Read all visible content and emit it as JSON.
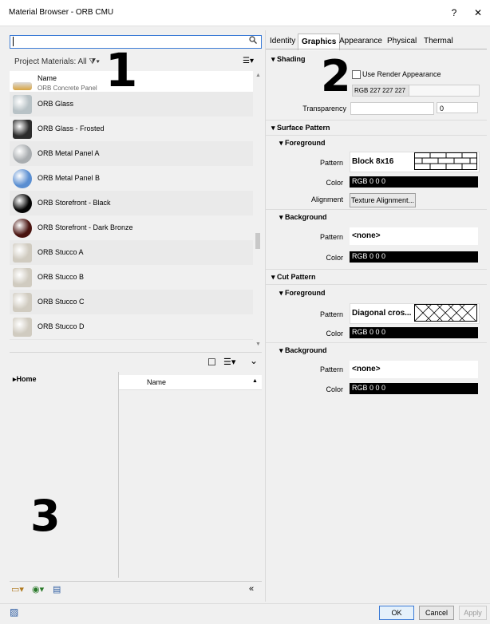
{
  "window": {
    "title": "Material Browser - ORB CMU",
    "help_label": "?",
    "close_label": "✕"
  },
  "search": {
    "value": "",
    "icon": "search-icon"
  },
  "project_materials": {
    "label": "Project Materials: All"
  },
  "list": {
    "column_header": "Name",
    "partial_item": "ORB Concrete Panel",
    "items": [
      {
        "label": "ORB Glass",
        "swatch": "#b8c2c6"
      },
      {
        "label": "ORB Glass - Frosted",
        "swatch": "#2c2c2c"
      },
      {
        "label": "ORB Metal Panel A",
        "swatch": "#a9adb0"
      },
      {
        "label": "ORB Metal Panel B",
        "swatch": "#5a8ed1"
      },
      {
        "label": "ORB Storefront - Black",
        "swatch": "#050505"
      },
      {
        "label": "ORB Storefront - Dark Bronze",
        "swatch": "#4a1410"
      },
      {
        "label": "ORB Stucco A",
        "swatch": "#d0cbc0"
      },
      {
        "label": "ORB Stucco B",
        "swatch": "#d0cbc0"
      },
      {
        "label": "ORB Stucco C",
        "swatch": "#d0cbc0"
      },
      {
        "label": "ORB Stucco D",
        "swatch": "#d0cbc0"
      }
    ]
  },
  "library": {
    "home_label": "Home",
    "name_header": "Name"
  },
  "callouts": {
    "one": "1",
    "two": "2",
    "three": "3"
  },
  "tabs": [
    {
      "label": "Identity"
    },
    {
      "label": "Graphics"
    },
    {
      "label": "Appearance"
    },
    {
      "label": "Physical"
    },
    {
      "label": "Thermal"
    }
  ],
  "graphics": {
    "shading": {
      "title": "Shading",
      "use_render_label": "Use Render Appearance",
      "color_value": "RGB 227 227 227",
      "transparency_label": "Transparency",
      "transparency_value": "0"
    },
    "surface_pattern": {
      "title": "Surface Pattern",
      "foreground": {
        "title": "Foreground",
        "pattern_label": "Pattern",
        "pattern_value": "Block 8x16",
        "color_label": "Color",
        "color_value": "RGB 0 0 0",
        "alignment_label": "Alignment",
        "alignment_button": "Texture Alignment..."
      },
      "background": {
        "title": "Background",
        "pattern_label": "Pattern",
        "pattern_value": "<none>",
        "color_label": "Color",
        "color_value": "RGB 0 0 0"
      }
    },
    "cut_pattern": {
      "title": "Cut Pattern",
      "foreground": {
        "title": "Foreground",
        "pattern_label": "Pattern",
        "pattern_value": "Diagonal cros...",
        "color_label": "Color",
        "color_value": "RGB 0 0 0"
      },
      "background": {
        "title": "Background",
        "pattern_label": "Pattern",
        "pattern_value": "<none>",
        "color_label": "Color",
        "color_value": "RGB 0 0 0"
      }
    }
  },
  "footer": {
    "ok": "OK",
    "cancel": "Cancel",
    "apply": "Apply"
  }
}
